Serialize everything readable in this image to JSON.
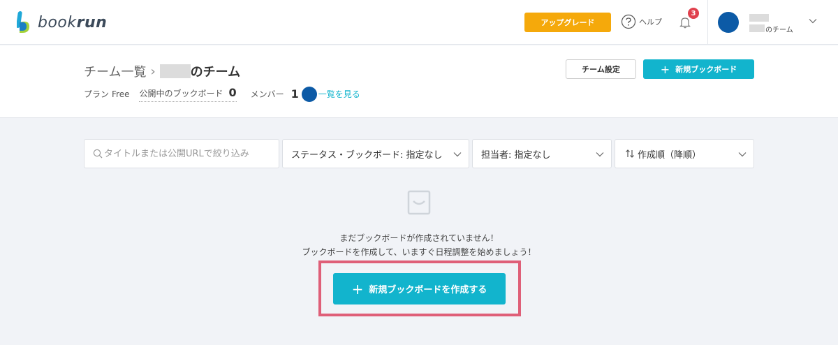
{
  "header": {
    "logo_text_light": "book",
    "logo_text_bold": "run",
    "upgrade_label": "アップグレード",
    "help_label": "ヘルプ",
    "notification_count": "3",
    "team_suffix": "のチーム"
  },
  "subheader": {
    "breadcrumb_parent": "チーム一覧",
    "breadcrumb_separator": "›",
    "team_suffix": "のチーム",
    "plan_label": "プラン",
    "plan_value": "Free",
    "public_boards_label": "公開中のブックボード",
    "public_boards_count": "0",
    "members_label": "メンバー",
    "members_count": "1",
    "members_link": "一覧を見る",
    "team_settings_label": "チーム設定",
    "new_board_label": "新規ブックボード"
  },
  "filters": {
    "search_placeholder": "タイトルまたは公開URLで絞り込み",
    "status_label": "ステータス・ブックボード: 指定なし",
    "assignee_label": "担当者: 指定なし",
    "sort_label": "作成順（降順）"
  },
  "empty_state": {
    "line1": "まだブックボードが作成されていません！",
    "line2": "ブックボードを作成して、いますぐ日程調整を始めましょう！",
    "create_button_label": "新規ブックボードを作成する"
  },
  "icons": {
    "plus": "plus-icon",
    "search": "search-icon",
    "help": "help-icon",
    "bell": "bell-icon",
    "chevron": "chevron-down-icon",
    "sort": "sort-icon",
    "inbox": "inbox-icon"
  },
  "colors": {
    "accent": "#12b4cd",
    "upgrade": "#f5a90b",
    "badge": "#e0414e",
    "avatar": "#0c5aa6",
    "highlight": "#df5f78"
  }
}
